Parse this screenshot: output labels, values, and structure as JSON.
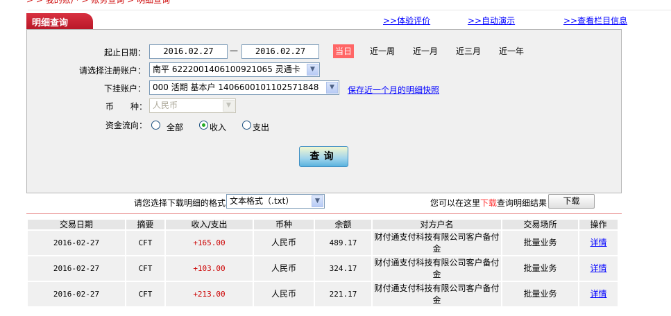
{
  "breadcrumb": "> > 我的账户 > 账务查询 > 明细查询",
  "panel_title": "明细查询",
  "top_links": [
    ">>体验评价",
    ">>自动演示",
    ">>查看栏目信息"
  ],
  "form": {
    "date_label": "起止日期：",
    "start_date": "2016.02.27",
    "dash": "—",
    "end_date": "2016.02.27",
    "quick_ranges": [
      "当日",
      "近一周",
      "近一月",
      "近三月",
      "近一年"
    ],
    "active_range": "当日",
    "account_label": "请选择注册账户：",
    "account_value": "南平  6222001406100921065  灵通卡",
    "subaccount_label": "下挂账户：",
    "subaccount_value": "000  活期  基本户  1406600101102571848",
    "snapshot_link": "保存近一个月的明细快照",
    "currency_label": "币　　种：",
    "currency_value": "人民币",
    "flow_label": "资金流向：",
    "flow_options": [
      "全部",
      "收入",
      "支出"
    ],
    "flow_selected": "收入",
    "query_button": "查询"
  },
  "download": {
    "format_label": "请您选择下载明细的格式",
    "format_value": "文本格式（.txt）",
    "hint_pre": "您可以在这里",
    "hint_red": "下载",
    "hint_post": "查询明细结果",
    "button": "下载"
  },
  "table": {
    "headers": [
      "交易日期",
      "摘要",
      "收入/支出",
      "币种",
      "余额",
      "对方户名",
      "交易场所",
      "操作"
    ],
    "rows": [
      [
        "2016-02-27",
        "CFT",
        "+165.00",
        "人民币",
        "489.17",
        "财付通支付科技有限公司客户备付金",
        "批量业务",
        "详情"
      ],
      [
        "2016-02-27",
        "CFT",
        "+103.00",
        "人民币",
        "324.17",
        "财付通支付科技有限公司客户备付金",
        "批量业务",
        "详情"
      ],
      [
        "2016-02-27",
        "CFT",
        "+213.00",
        "人民币",
        "221.17",
        "财付通支付科技有限公司客户备付金",
        "批量业务",
        "详情"
      ]
    ]
  },
  "colors": {
    "tab": "#c8202f",
    "active_range": "#ff6666",
    "amount": "#cc0000",
    "link": "#0000ff"
  }
}
